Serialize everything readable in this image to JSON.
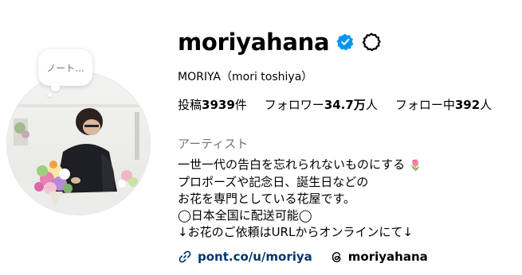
{
  "note": {
    "text": "ノート..."
  },
  "profile": {
    "username": "moriyahana",
    "full_name": "MORIYA（mori toshiya）",
    "verified": true
  },
  "stats": {
    "posts_label": "投稿",
    "posts_count": "3939",
    "posts_suffix": "件",
    "followers_label": "フォロワー",
    "followers_count": "34.7万",
    "followers_suffix": "人",
    "following_label": "フォロー中",
    "following_count": "392",
    "following_suffix": "人"
  },
  "category": "アーティスト",
  "bio": {
    "line1": "一世一代の告白を忘れられないものにする",
    "line1_emoji": "🌷",
    "line2": "プロポーズや記念日、誕生日などの",
    "line3": "お花を専門としている花屋です。",
    "line4": "◯日本全国に配送可能◯",
    "line5": "↓お花のご依頼はURLからオンラインにて↓"
  },
  "links": {
    "website": "pont.co/u/moriya",
    "threads": "moriyahana"
  },
  "icons": {
    "verified": "verified-badge-icon",
    "settings": "settings-gear-icon",
    "link": "link-icon",
    "threads": "threads-icon"
  },
  "colors": {
    "verified_blue": "#0095f6",
    "link_blue": "#00376b",
    "muted_text": "#737373"
  }
}
